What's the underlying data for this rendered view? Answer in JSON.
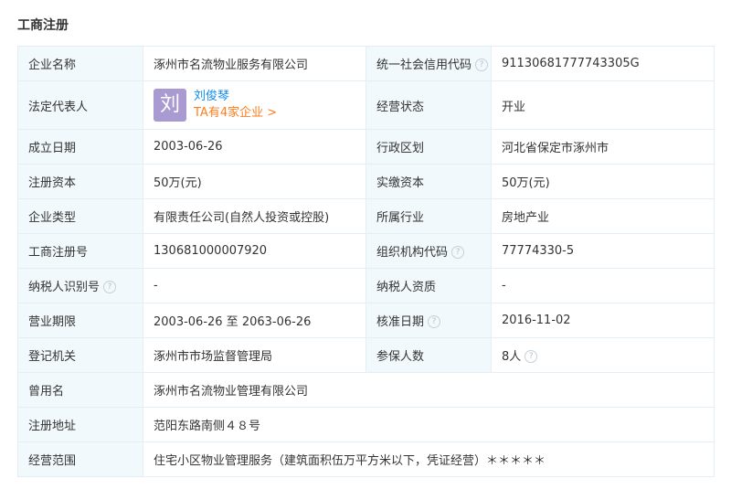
{
  "section_title": "工商注册",
  "help_icon_glyph": "?",
  "rows": [
    {
      "l1": "企业名称",
      "v1": "涿州市名流物业服务有限公司",
      "l2": "统一社会信用代码",
      "v2": "91130681777743305G"
    },
    {
      "l1": "法定代表人",
      "l2": "经营状态",
      "v2": "开业"
    },
    {
      "l1": "成立日期",
      "v1": "2003-06-26",
      "l2": "行政区划",
      "v2": "河北省保定市涿州市"
    },
    {
      "l1": "注册资本",
      "v1": "50万(元)",
      "l2": "实缴资本",
      "v2": "50万(元)"
    },
    {
      "l1": "企业类型",
      "v1": "有限责任公司(自然人投资或控股)",
      "l2": "所属行业",
      "v2": "房地产业"
    },
    {
      "l1": "工商注册号",
      "v1": "130681000007920",
      "l2": "组织机构代码",
      "v2": "77774330-5"
    },
    {
      "l1": "纳税人识别号",
      "v1": "-",
      "l2": "纳税人资质",
      "v2": "-"
    },
    {
      "l1": "营业期限",
      "v1": "2003-06-26 至 2063-06-26",
      "l2": "核准日期",
      "v2": "2016-11-02"
    },
    {
      "l1": "登记机关",
      "v1": "涿州市市场监督管理局",
      "l2": "参保人数",
      "v2": "8人"
    }
  ],
  "legal_rep": {
    "avatar_char": "刘",
    "name": "刘俊琴",
    "link": "TA有4家企业 >"
  },
  "wide_rows": [
    {
      "label": "曾用名",
      "value": "涿州市名流物业管理有限公司"
    },
    {
      "label": "注册地址",
      "value": "范阳东路南侧４８号"
    },
    {
      "label": "经营范围",
      "value": "住宅小区物业管理服务（建筑面积伍万平方米以下，凭证经营）＊＊＊＊＊"
    }
  ],
  "colors": {
    "label_bg": "#f2f9fc",
    "border": "#e4eef6",
    "link_blue": "#128bed",
    "link_orange": "#ff7d1e",
    "avatar_bg": "#a99bd2"
  }
}
